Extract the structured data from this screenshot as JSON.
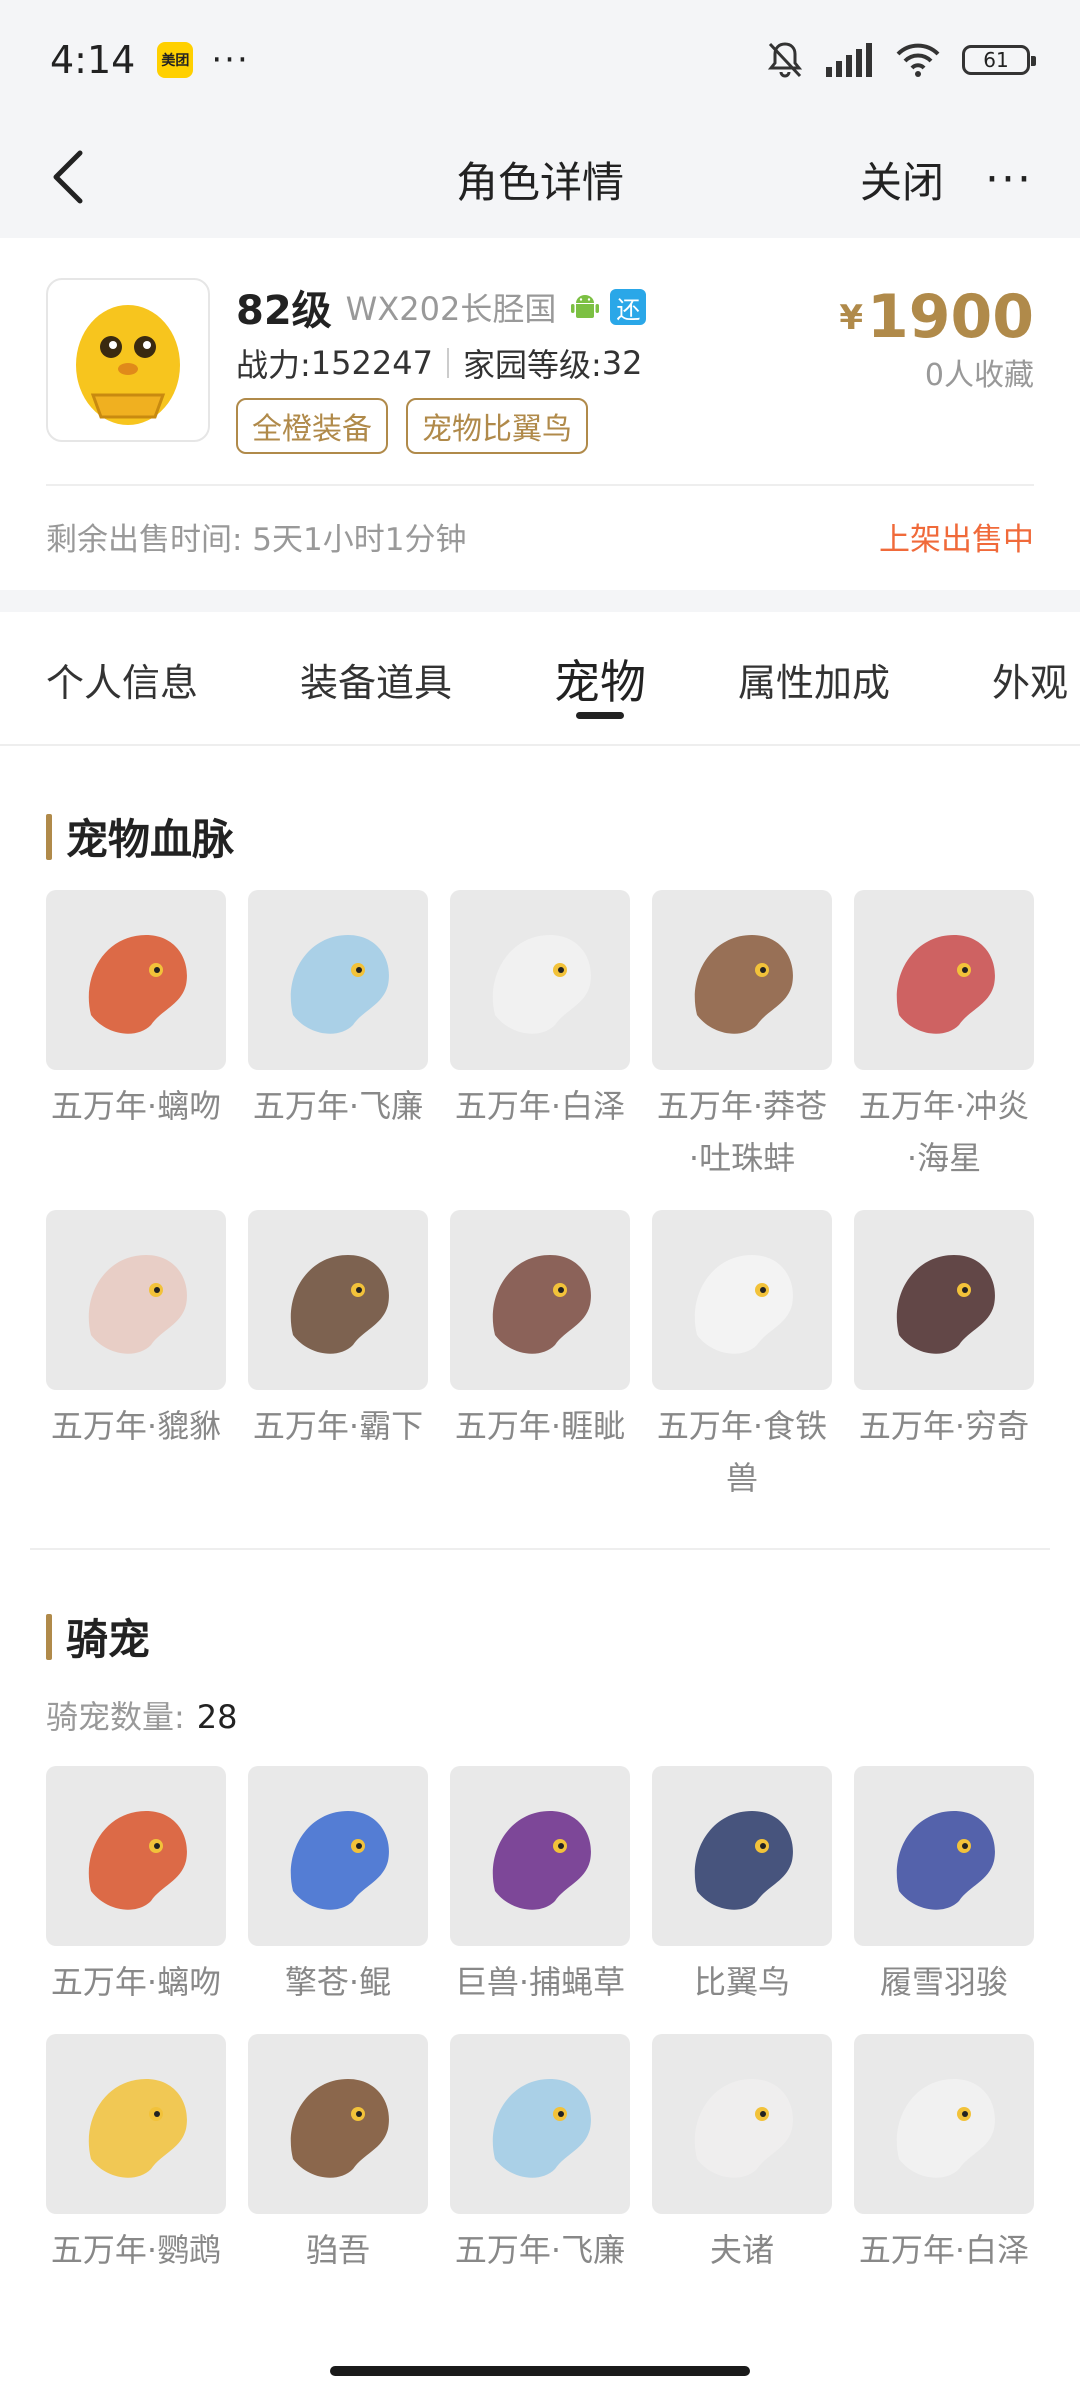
{
  "status_bar": {
    "time": "4:14",
    "app_badge": "美团",
    "more": "···",
    "battery": "61"
  },
  "nav": {
    "title": "角色详情",
    "close": "关闭",
    "more": "···"
  },
  "role": {
    "level": "82级",
    "server": "WX202长胫国",
    "huan_badge": "还",
    "power_label": "战力: ",
    "power": "152247",
    "home_label": "家园等级: ",
    "home_level": "32",
    "tags": [
      "全橙装备",
      "宠物比翼鸟"
    ],
    "price_symbol": "¥",
    "price": "1900",
    "favorites": "0人收藏",
    "remain": "剩余出售时间: 5天1小时1分钟",
    "status": "上架出售中"
  },
  "tabs": [
    {
      "label": "个人信息"
    },
    {
      "label": "装备道具"
    },
    {
      "label": "宠物"
    },
    {
      "label": "属性加成"
    },
    {
      "label": "外观"
    }
  ],
  "active_tab": "宠物",
  "bloodline": {
    "title": "宠物血脉",
    "pets": [
      {
        "name": "五万年·螭吻",
        "icon": "螭吻-icon",
        "color": "#d9532a"
      },
      {
        "name": "五万年·飞廉",
        "icon": "飞廉-icon",
        "color": "#9fcbe6"
      },
      {
        "name": "五万年·白泽",
        "icon": "白泽-icon",
        "color": "#f2f2f2"
      },
      {
        "name": "五万年·莽苍·吐珠蚌",
        "icon": "吐珠蚌-icon",
        "color": "#8a5a3c"
      },
      {
        "name": "五万年·冲炎·海星",
        "icon": "海星-icon",
        "color": "#c94a4a"
      },
      {
        "name": "五万年·貔貅",
        "icon": "貔貅-icon",
        "color": "#e8c9c0"
      },
      {
        "name": "五万年·霸下",
        "icon": "霸下-icon",
        "color": "#6a4a35"
      },
      {
        "name": "五万年·睚眦",
        "icon": "睚眦-icon",
        "color": "#7a4a40"
      },
      {
        "name": "五万年·食铁兽",
        "icon": "食铁兽-icon",
        "color": "#f5f5f5"
      },
      {
        "name": "五万年·穷奇",
        "icon": "穷奇-icon",
        "color": "#4a2a2a"
      }
    ]
  },
  "mounts": {
    "title": "骑宠",
    "count_label": "骑宠数量:",
    "count": "28",
    "pets": [
      {
        "name": "五万年·螭吻",
        "icon": "螭吻-icon",
        "color": "#d9532a"
      },
      {
        "name": "擎苍·鲲",
        "icon": "鲲-icon",
        "color": "#3a6ad0"
      },
      {
        "name": "巨兽·捕蝇草",
        "icon": "捕蝇草-icon",
        "color": "#6a2a8a"
      },
      {
        "name": "比翼鸟",
        "icon": "比翼鸟-icon",
        "color": "#2a3a6a"
      },
      {
        "name": "履雪羽骏",
        "icon": "履雪羽骏-icon",
        "color": "#3a4aa0"
      },
      {
        "name": "五万年·鹦鹉",
        "icon": "鹦鹉-icon",
        "color": "#f2c23a"
      },
      {
        "name": "驺吾",
        "icon": "驺吾-icon",
        "color": "#7a5030"
      },
      {
        "name": "五万年·飞廉",
        "icon": "飞廉-icon",
        "color": "#9fcbe6"
      },
      {
        "name": "夫诸",
        "icon": "夫诸-icon",
        "color": "#f0eeee"
      },
      {
        "name": "五万年·白泽",
        "icon": "白泽-icon",
        "color": "#f2f2f2"
      }
    ]
  }
}
